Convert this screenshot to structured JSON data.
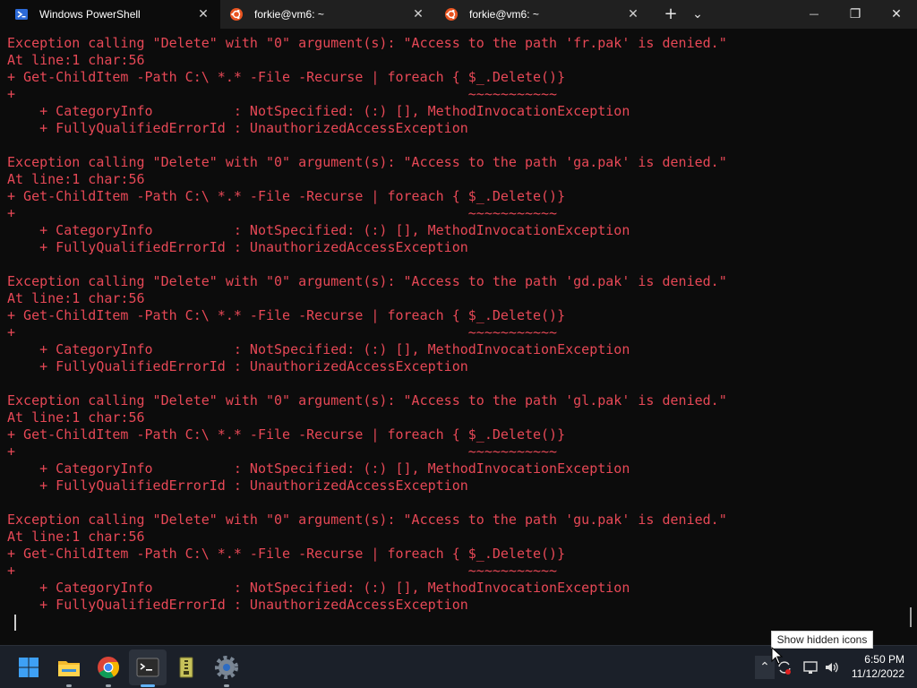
{
  "window": {
    "tabs": [
      {
        "label": "Windows PowerShell",
        "icon": "powershell-icon",
        "active": true
      },
      {
        "label": "forkie@vm6: ~",
        "icon": "ubuntu-icon",
        "active": false
      },
      {
        "label": "forkie@vm6: ~",
        "icon": "ubuntu-icon",
        "active": false
      }
    ],
    "new_tab_symbol": "+",
    "dropdown_symbol": "⌄",
    "minimize_symbol": "—",
    "maximize_symbol": "❐",
    "close_symbol": "✕"
  },
  "terminal": {
    "error_color": "#e74856",
    "lines": [
      "Exception calling \"Delete\" with \"0\" argument(s): \"Access to the path 'fr.pak' is denied.\"",
      "At line:1 char:56",
      "+ Get-ChildItem -Path C:\\ *.* -File -Recurse | foreach { $_.Delete()}",
      "+                                                        ~~~~~~~~~~~",
      "    + CategoryInfo          : NotSpecified: (:) [], MethodInvocationException",
      "    + FullyQualifiedErrorId : UnauthorizedAccessException",
      "",
      "Exception calling \"Delete\" with \"0\" argument(s): \"Access to the path 'ga.pak' is denied.\"",
      "At line:1 char:56",
      "+ Get-ChildItem -Path C:\\ *.* -File -Recurse | foreach { $_.Delete()}",
      "+                                                        ~~~~~~~~~~~",
      "    + CategoryInfo          : NotSpecified: (:) [], MethodInvocationException",
      "    + FullyQualifiedErrorId : UnauthorizedAccessException",
      "",
      "Exception calling \"Delete\" with \"0\" argument(s): \"Access to the path 'gd.pak' is denied.\"",
      "At line:1 char:56",
      "+ Get-ChildItem -Path C:\\ *.* -File -Recurse | foreach { $_.Delete()}",
      "+                                                        ~~~~~~~~~~~",
      "    + CategoryInfo          : NotSpecified: (:) [], MethodInvocationException",
      "    + FullyQualifiedErrorId : UnauthorizedAccessException",
      "",
      "Exception calling \"Delete\" with \"0\" argument(s): \"Access to the path 'gl.pak' is denied.\"",
      "At line:1 char:56",
      "+ Get-ChildItem -Path C:\\ *.* -File -Recurse | foreach { $_.Delete()}",
      "+                                                        ~~~~~~~~~~~",
      "    + CategoryInfo          : NotSpecified: (:) [], MethodInvocationException",
      "    + FullyQualifiedErrorId : UnauthorizedAccessException",
      "",
      "Exception calling \"Delete\" with \"0\" argument(s): \"Access to the path 'gu.pak' is denied.\"",
      "At line:1 char:56",
      "+ Get-ChildItem -Path C:\\ *.* -File -Recurse | foreach { $_.Delete()}",
      "+                                                        ~~~~~~~~~~~",
      "    + CategoryInfo          : NotSpecified: (:) [], MethodInvocationException",
      "    + FullyQualifiedErrorId : UnauthorizedAccessException"
    ]
  },
  "taskbar": {
    "apps": [
      {
        "name": "start-button",
        "icon": "windows-logo-icon"
      },
      {
        "name": "file-explorer",
        "icon": "folder-icon"
      },
      {
        "name": "chrome",
        "icon": "chrome-icon"
      },
      {
        "name": "terminal",
        "icon": "terminal-icon"
      },
      {
        "name": "archive-app",
        "icon": "archive-icon"
      },
      {
        "name": "settings",
        "icon": "gear-icon"
      }
    ],
    "tray": {
      "tooltip": "Show hidden icons",
      "time": "6:50 PM",
      "date": "11/12/2022"
    }
  }
}
